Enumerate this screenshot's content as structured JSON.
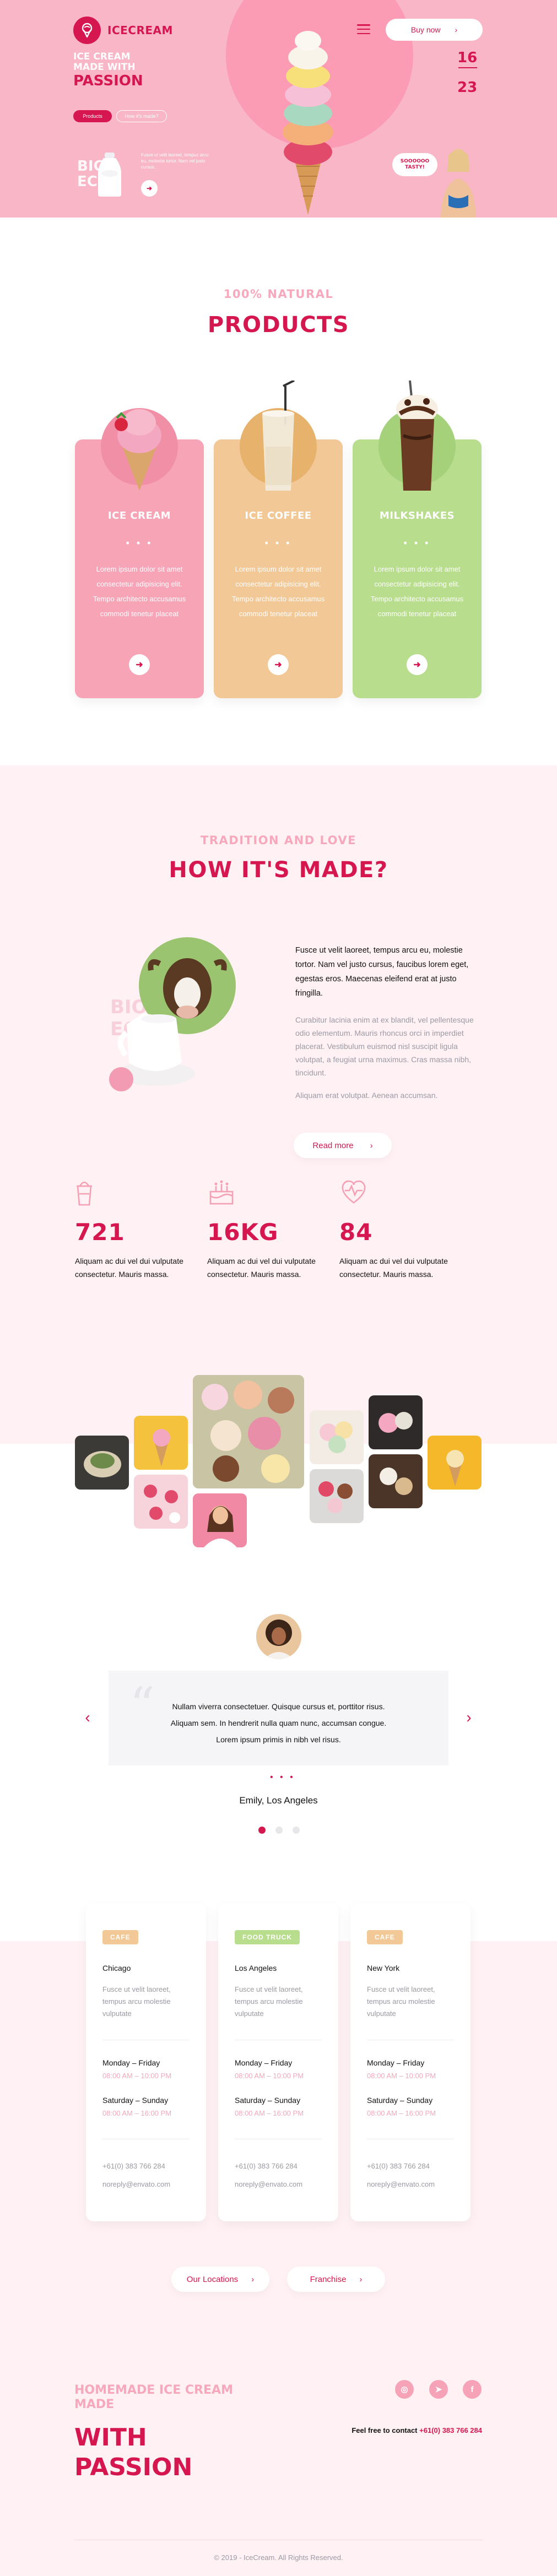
{
  "brand": {
    "name": "ICECREAM",
    "accent": "#d5164f",
    "pink": "#f8b6c7"
  },
  "hero": {
    "title_line1": "ICE CREAM",
    "title_line2": "MADE WITH",
    "title_line3": "PASSION",
    "btn_primary": "Products",
    "btn_secondary": "How it's made?",
    "ghost_text_1": "BIG",
    "ghost_text_2": "ECO",
    "copy": "Fusce ut velit laoreet, tempus arcu eu, molestie tortor. Nam vel justo cursus.",
    "buy_label": "Buy now",
    "slide_current": "16",
    "slide_total": "23",
    "bubble": "SOOOOOO TASTY!"
  },
  "products": {
    "eyebrow": "100% NATURAL",
    "title": "PRODUCTS",
    "items": [
      {
        "name": "ICE CREAM",
        "dots": "• • •",
        "desc": "Lorem ipsum dolor sit amet consectetur adipisicing elit. Tempo architecto accusamus commodi tenetur placeat",
        "color": "#f7a4b7"
      },
      {
        "name": "ICE COFFEE",
        "dots": "• • •",
        "desc": "Lorem ipsum dolor sit amet consectetur adipisicing elit. Tempo architecto accusamus commodi tenetur placeat",
        "color": "#f2c896"
      },
      {
        "name": "MILKSHAKES",
        "dots": "• • •",
        "desc": "Lorem ipsum dolor sit amet consectetur adipisicing elit. Tempo architecto accusamus commodi tenetur placeat",
        "color": "#b7dd8d"
      }
    ]
  },
  "made": {
    "eyebrow": "TRADITION AND LOVE",
    "title": "HOW IT'S MADE?",
    "strong": "Fusce ut velit laoreet, tempus arcu eu, molestie tortor. Nam vel justo cursus, faucibus lorem eget, egestas eros. Maecenas eleifend erat at justo fringilla.",
    "text1": "Curabitur lacinia enim at ex blandit, vel pellentesque odio elementum. Mauris rhoncus orci in imperdiet placerat. Vestibulum euismod nisl suscipit ligula volutpat, a feugiat urna maximus. Cras massa nibh, tincidunt.",
    "text2": "Aliquam erat volutpat. Aenean accumsan.",
    "readmore": "Read more",
    "stats": [
      {
        "value": "721",
        "text": "Aliquam ac dui vel dui vulputate consectetur. Mauris massa.",
        "icon": "cup-icon"
      },
      {
        "value": "16KG",
        "text": "Aliquam ac dui vel dui vulputate consectetur. Mauris massa.",
        "icon": "cake-icon"
      },
      {
        "value": "84",
        "text": "Aliquam ac dui vel dui vulputate consectetur. Mauris massa.",
        "icon": "heart-pulse-icon"
      }
    ]
  },
  "testimonial": {
    "quote_mark": "“",
    "line1": "Nullam viverra consectetuer. Quisque cursus et, porttitor risus.",
    "line2": "Aliquam sem. In hendrerit nulla quam nunc, accumsan congue.",
    "line3": "Lorem ipsum primis in nibh vel risus.",
    "dots": "• • •",
    "name": "Emily, Los Angeles"
  },
  "locations": {
    "cards": [
      {
        "badge": "CAFE",
        "badge_color": "#f2c896",
        "city": "Chicago",
        "desc": "Fusce ut velit laoreet, tempus arcu molestie vulputate",
        "day1": "Monday – Friday",
        "hours1": "08:00 AM – 10:00 PM",
        "day2": "Saturday – Sunday",
        "hours2": "08:00 AM – 16:00 PM",
        "phone": "+61(0) 383 766 284",
        "email": "noreply@envato.com"
      },
      {
        "badge": "FOOD TRUCK",
        "badge_color": "#b7dd8d",
        "city": "Los Angeles",
        "desc": "Fusce ut velit laoreet, tempus arcu molestie vulputate",
        "day1": "Monday – Friday",
        "hours1": "08:00 AM – 10:00 PM",
        "day2": "Saturday – Sunday",
        "hours2": "08:00 AM – 16:00 PM",
        "phone": "+61(0) 383 766 284",
        "email": "noreply@envato.com"
      },
      {
        "badge": "CAFE",
        "badge_color": "#f2c896",
        "city": "New York",
        "desc": "Fusce ut velit laoreet, tempus arcu molestie vulputate",
        "day1": "Monday – Friday",
        "hours1": "08:00 AM – 10:00 PM",
        "day2": "Saturday – Sunday",
        "hours2": "08:00 AM – 16:00 PM",
        "phone": "+61(0) 383 766 284",
        "email": "noreply@envato.com"
      }
    ],
    "btn_locations": "Our Locations",
    "btn_franchise": "Franchise"
  },
  "footer": {
    "small1": "HOMEMADE ICE CREAM",
    "small2": "MADE",
    "big1": "WITH",
    "big2": "PASSION",
    "contact_label": "Feel free to contact",
    "contact_phone": "+61(0) 383 766 284",
    "copyright": "© 2019 - IceCream. All Rights Reserved."
  }
}
